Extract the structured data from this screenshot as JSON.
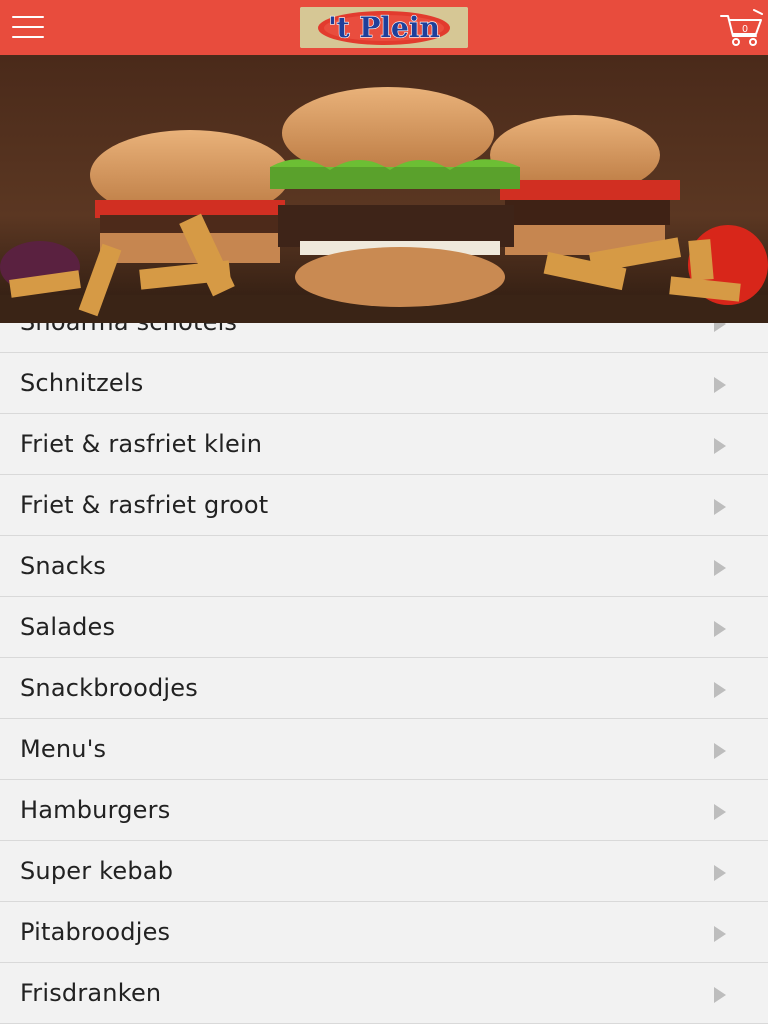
{
  "header": {
    "logo_text": "'t Plein",
    "cart_count": "0",
    "menu_icon": "hamburger-menu-icon",
    "cart_icon": "shopping-cart-icon",
    "accent_color": "#e84c3d"
  },
  "hero": {
    "image": "burgers-and-fries-photo"
  },
  "categories": [
    {
      "label": "Shoarma schotels"
    },
    {
      "label": "Schnitzels"
    },
    {
      "label": "Friet & rasfriet klein"
    },
    {
      "label": "Friet & rasfriet groot"
    },
    {
      "label": "Snacks"
    },
    {
      "label": "Salades"
    },
    {
      "label": "Snackbroodjes"
    },
    {
      "label": "Menu's"
    },
    {
      "label": "Hamburgers"
    },
    {
      "label": "Super kebab"
    },
    {
      "label": "Pitabroodjes"
    },
    {
      "label": "Frisdranken"
    }
  ]
}
